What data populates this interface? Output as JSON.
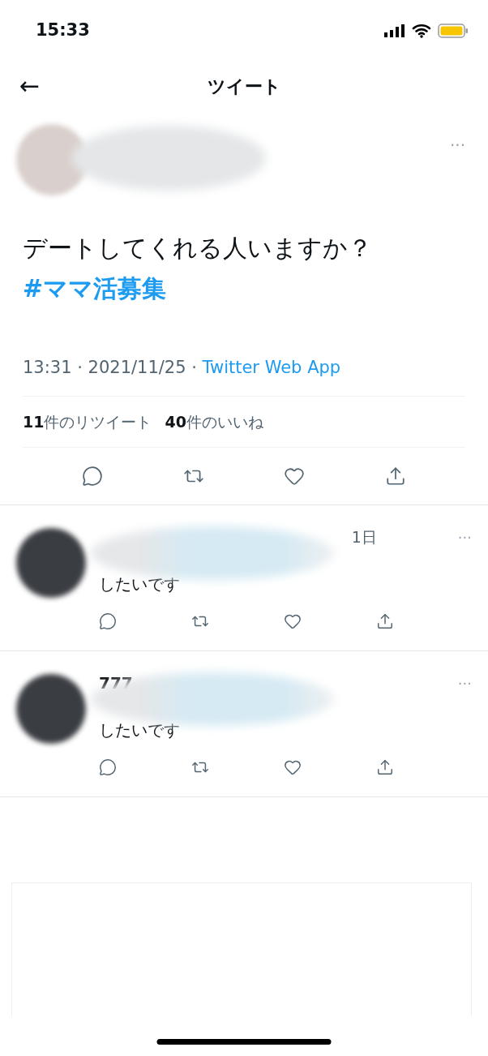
{
  "status_bar": {
    "time": "15:33"
  },
  "header": {
    "back": "←",
    "title": "ツイート"
  },
  "tweet": {
    "menu": "···",
    "text": "デートしてくれる人いますか？ ",
    "hashtag": "#ママ活募集",
    "time": "13:31 · 2021/11/25 · ",
    "source": "Twitter Web App",
    "stats": [
      "**11**件のリツイート",
      "**40**件のいいね"
    ]
  },
  "replies": [
    {
      "time": "1日",
      "text": "したいです",
      "menu": "···"
    },
    {
      "name": "777",
      "text": "したいです",
      "menu": "···"
    }
  ]
}
